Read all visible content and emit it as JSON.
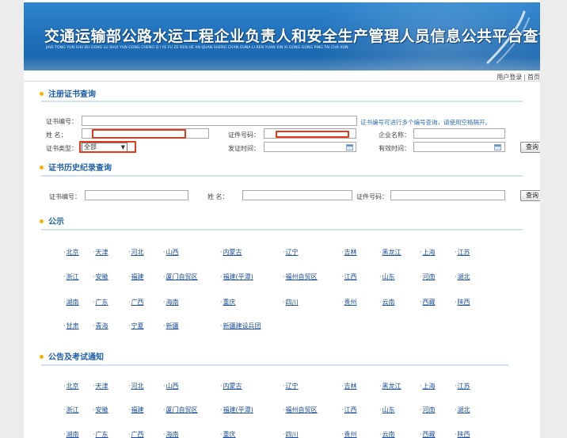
{
  "banner": {
    "title": "交通运输部公路水运工程企业负责人和安全生产管理人员信息公共平台查询",
    "pinyin": "JIAO TONG YUN SHU BU GONG LU SHUI YUN GONG CHENG Q I YE FU ZE REN HE AN QUAN SHENG CHAN GUNA LI REN YUAN XIN XI GONG GONG PING TAI CHA XUN"
  },
  "top_links": {
    "login": "用户登录",
    "separator": "|",
    "home": "首页"
  },
  "sections": {
    "cert_query": "注册证书查询",
    "history_query": "证书历史纪录查询",
    "notice": "公示",
    "exam_notice": "公告及考试通知"
  },
  "cert_form": {
    "cert_no_label": "证书编号：",
    "cert_no_value": "",
    "cert_no_hint": "证书编号可进行多个编号查询，请使用空格隔开。",
    "name_label": "姓    名：",
    "name_value": "",
    "id_label": "证件号码：",
    "id_value": "",
    "company_label": "企业名称：",
    "company_value": "",
    "type_label": "证书类型：",
    "type_value": "全部",
    "issue_label": "发证时间：",
    "issue_value": "",
    "valid_label": "有效时间：",
    "valid_value": "",
    "query_button": "查询"
  },
  "history_form": {
    "cert_no_label": "证书编号：",
    "cert_no_value": "",
    "name_label": "姓    名：",
    "name_value": "",
    "id_label": "证件号码：",
    "id_value": "",
    "query_button": "查询"
  },
  "notice_regions": [
    [
      "北京",
      "天津",
      "河北",
      "山西",
      "内蒙古",
      "辽宁",
      "吉林",
      "黑龙江",
      "上海",
      "江苏"
    ],
    [
      "浙江",
      "安徽",
      "福建",
      "厦门自贸区",
      "福建(平潭)",
      "福州自贸区",
      "江西",
      "山东",
      "河南",
      "湖北"
    ],
    [
      "湖南",
      "广东",
      "广西",
      "海南",
      "重庆",
      "四川",
      "贵州",
      "云南",
      "西藏",
      "陕西"
    ],
    [
      "甘肃",
      "青海",
      "宁夏",
      "新疆",
      "新疆建设兵团"
    ]
  ],
  "exam_regions": [
    [
      "北京",
      "天津",
      "河北",
      "山西",
      "内蒙古",
      "辽宁",
      "吉林",
      "黑龙江",
      "上海",
      "江苏"
    ],
    [
      "浙江",
      "安徽",
      "福建",
      "厦门自贸区",
      "福建(平潭)",
      "福州自贸区",
      "江西",
      "山东",
      "河南",
      "湖北"
    ],
    [
      "湖南",
      "广东",
      "广西",
      "海南",
      "重庆",
      "四川",
      "贵州",
      "云南",
      "西藏",
      "陕西"
    ]
  ],
  "colors": {
    "banner_blue": "#1e6fb8",
    "section_title": "#1e5fa6",
    "bullet": "#f0b400",
    "annotation_red": "#e5391f",
    "link": "#1d4f9c"
  }
}
